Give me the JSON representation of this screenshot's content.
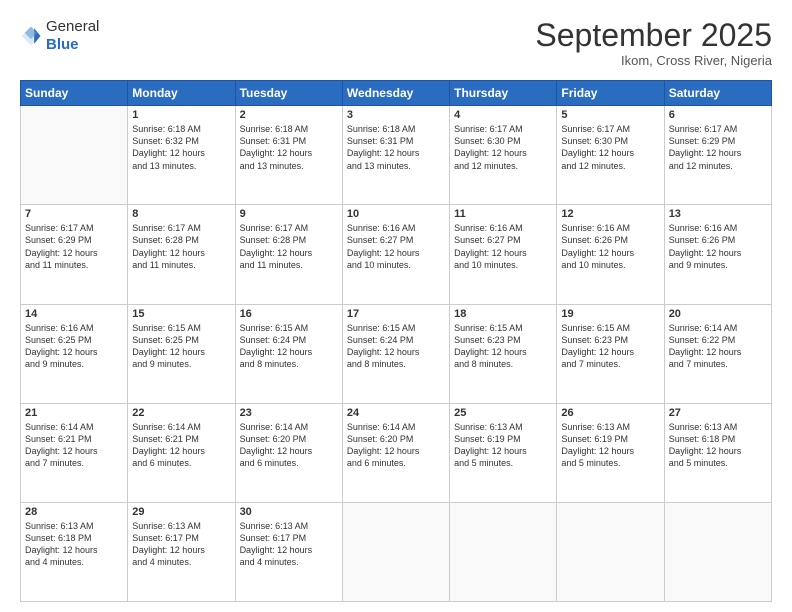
{
  "logo": {
    "general": "General",
    "blue": "Blue"
  },
  "header": {
    "month": "September 2025",
    "location": "Ikom, Cross River, Nigeria"
  },
  "days": [
    "Sunday",
    "Monday",
    "Tuesday",
    "Wednesday",
    "Thursday",
    "Friday",
    "Saturday"
  ],
  "weeks": [
    [
      {
        "num": "",
        "info": ""
      },
      {
        "num": "1",
        "info": "Sunrise: 6:18 AM\nSunset: 6:32 PM\nDaylight: 12 hours\nand 13 minutes."
      },
      {
        "num": "2",
        "info": "Sunrise: 6:18 AM\nSunset: 6:31 PM\nDaylight: 12 hours\nand 13 minutes."
      },
      {
        "num": "3",
        "info": "Sunrise: 6:18 AM\nSunset: 6:31 PM\nDaylight: 12 hours\nand 13 minutes."
      },
      {
        "num": "4",
        "info": "Sunrise: 6:17 AM\nSunset: 6:30 PM\nDaylight: 12 hours\nand 12 minutes."
      },
      {
        "num": "5",
        "info": "Sunrise: 6:17 AM\nSunset: 6:30 PM\nDaylight: 12 hours\nand 12 minutes."
      },
      {
        "num": "6",
        "info": "Sunrise: 6:17 AM\nSunset: 6:29 PM\nDaylight: 12 hours\nand 12 minutes."
      }
    ],
    [
      {
        "num": "7",
        "info": "Sunrise: 6:17 AM\nSunset: 6:29 PM\nDaylight: 12 hours\nand 11 minutes."
      },
      {
        "num": "8",
        "info": "Sunrise: 6:17 AM\nSunset: 6:28 PM\nDaylight: 12 hours\nand 11 minutes."
      },
      {
        "num": "9",
        "info": "Sunrise: 6:17 AM\nSunset: 6:28 PM\nDaylight: 12 hours\nand 11 minutes."
      },
      {
        "num": "10",
        "info": "Sunrise: 6:16 AM\nSunset: 6:27 PM\nDaylight: 12 hours\nand 10 minutes."
      },
      {
        "num": "11",
        "info": "Sunrise: 6:16 AM\nSunset: 6:27 PM\nDaylight: 12 hours\nand 10 minutes."
      },
      {
        "num": "12",
        "info": "Sunrise: 6:16 AM\nSunset: 6:26 PM\nDaylight: 12 hours\nand 10 minutes."
      },
      {
        "num": "13",
        "info": "Sunrise: 6:16 AM\nSunset: 6:26 PM\nDaylight: 12 hours\nand 9 minutes."
      }
    ],
    [
      {
        "num": "14",
        "info": "Sunrise: 6:16 AM\nSunset: 6:25 PM\nDaylight: 12 hours\nand 9 minutes."
      },
      {
        "num": "15",
        "info": "Sunrise: 6:15 AM\nSunset: 6:25 PM\nDaylight: 12 hours\nand 9 minutes."
      },
      {
        "num": "16",
        "info": "Sunrise: 6:15 AM\nSunset: 6:24 PM\nDaylight: 12 hours\nand 8 minutes."
      },
      {
        "num": "17",
        "info": "Sunrise: 6:15 AM\nSunset: 6:24 PM\nDaylight: 12 hours\nand 8 minutes."
      },
      {
        "num": "18",
        "info": "Sunrise: 6:15 AM\nSunset: 6:23 PM\nDaylight: 12 hours\nand 8 minutes."
      },
      {
        "num": "19",
        "info": "Sunrise: 6:15 AM\nSunset: 6:23 PM\nDaylight: 12 hours\nand 7 minutes."
      },
      {
        "num": "20",
        "info": "Sunrise: 6:14 AM\nSunset: 6:22 PM\nDaylight: 12 hours\nand 7 minutes."
      }
    ],
    [
      {
        "num": "21",
        "info": "Sunrise: 6:14 AM\nSunset: 6:21 PM\nDaylight: 12 hours\nand 7 minutes."
      },
      {
        "num": "22",
        "info": "Sunrise: 6:14 AM\nSunset: 6:21 PM\nDaylight: 12 hours\nand 6 minutes."
      },
      {
        "num": "23",
        "info": "Sunrise: 6:14 AM\nSunset: 6:20 PM\nDaylight: 12 hours\nand 6 minutes."
      },
      {
        "num": "24",
        "info": "Sunrise: 6:14 AM\nSunset: 6:20 PM\nDaylight: 12 hours\nand 6 minutes."
      },
      {
        "num": "25",
        "info": "Sunrise: 6:13 AM\nSunset: 6:19 PM\nDaylight: 12 hours\nand 5 minutes."
      },
      {
        "num": "26",
        "info": "Sunrise: 6:13 AM\nSunset: 6:19 PM\nDaylight: 12 hours\nand 5 minutes."
      },
      {
        "num": "27",
        "info": "Sunrise: 6:13 AM\nSunset: 6:18 PM\nDaylight: 12 hours\nand 5 minutes."
      }
    ],
    [
      {
        "num": "28",
        "info": "Sunrise: 6:13 AM\nSunset: 6:18 PM\nDaylight: 12 hours\nand 4 minutes."
      },
      {
        "num": "29",
        "info": "Sunrise: 6:13 AM\nSunset: 6:17 PM\nDaylight: 12 hours\nand 4 minutes."
      },
      {
        "num": "30",
        "info": "Sunrise: 6:13 AM\nSunset: 6:17 PM\nDaylight: 12 hours\nand 4 minutes."
      },
      {
        "num": "",
        "info": ""
      },
      {
        "num": "",
        "info": ""
      },
      {
        "num": "",
        "info": ""
      },
      {
        "num": "",
        "info": ""
      }
    ]
  ]
}
